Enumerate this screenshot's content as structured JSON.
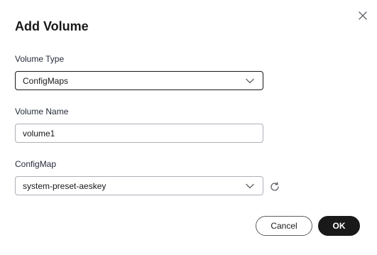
{
  "dialog": {
    "title": "Add Volume",
    "close_icon": "close-icon"
  },
  "form": {
    "volume_type": {
      "label": "Volume Type",
      "value": "ConfigMaps"
    },
    "volume_name": {
      "label": "Volume Name",
      "value": "volume1"
    },
    "configmap": {
      "label": "ConfigMap",
      "value": "system-preset-aeskey",
      "refresh_icon": "refresh-icon"
    }
  },
  "footer": {
    "cancel_label": "Cancel",
    "ok_label": "OK"
  },
  "colors": {
    "primary_button": "#191919",
    "border": "#adb0b8",
    "active_border": "#191919"
  }
}
